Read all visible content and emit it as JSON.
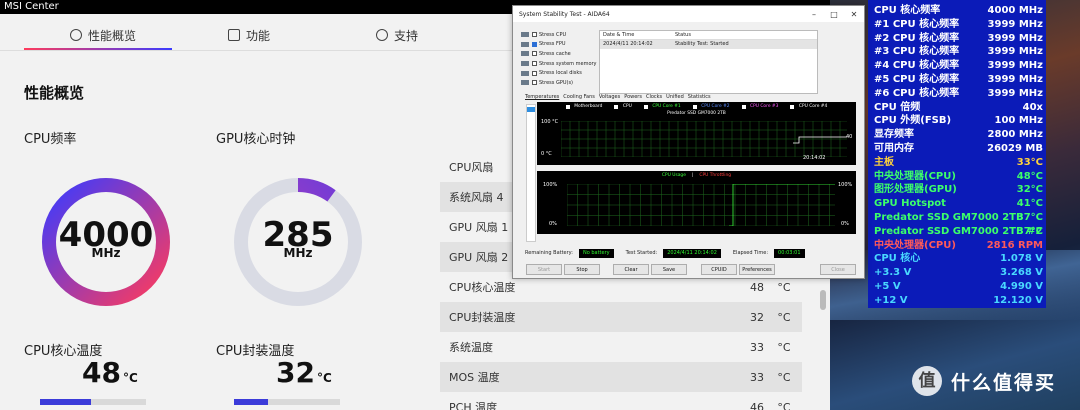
{
  "msi": {
    "title": "MSI Center",
    "tabs": [
      {
        "label": "性能概览",
        "icon": "speedometer-icon",
        "active": true
      },
      {
        "label": "功能",
        "icon": "function-icon",
        "active": false
      },
      {
        "label": "支持",
        "icon": "help-icon",
        "active": false
      }
    ],
    "section_title": "性能概览",
    "cpu_freq": {
      "label": "CPU频率",
      "value": "4000",
      "unit": "MHz",
      "fraction": 1.0
    },
    "gpu_clock": {
      "label": "GPU核心时钟",
      "value": "285",
      "unit": "MHz",
      "fraction": 0.1
    },
    "cpu_core_temp": {
      "label": "CPU核心温度",
      "value": "48",
      "unit": "°C",
      "fraction": 0.48
    },
    "cpu_pkg_temp": {
      "label": "CPU封装温度",
      "value": "32",
      "unit": "°C",
      "fraction": 0.32
    },
    "fans": [
      {
        "name": "CPU风扇",
        "value": "",
        "unit": ""
      },
      {
        "name": "系统风扇 4",
        "value": "",
        "unit": ""
      },
      {
        "name": "GPU 风扇 1",
        "value": "",
        "unit": ""
      },
      {
        "name": "GPU 风扇 2",
        "value": "",
        "unit": ""
      },
      {
        "name": "CPU核心温度",
        "value": "48",
        "unit": "°C"
      },
      {
        "name": "CPU封装温度",
        "value": "32",
        "unit": "°C"
      },
      {
        "name": "系统温度",
        "value": "33",
        "unit": "°C"
      },
      {
        "name": "MOS 温度",
        "value": "33",
        "unit": "°C"
      },
      {
        "name": "PCH 温度",
        "value": "46",
        "unit": "°C"
      }
    ],
    "accent_gradient": [
      "#ff3b5c",
      "#3b3bff"
    ]
  },
  "osd": {
    "rows": [
      {
        "key": "CPU 核心频率",
        "value": "4000 MHz",
        "color": "#ffffff"
      },
      {
        "key": "#1 CPU 核心频率",
        "value": "3999 MHz",
        "color": "#ffffff"
      },
      {
        "key": "#2 CPU 核心频率",
        "value": "3999 MHz",
        "color": "#ffffff"
      },
      {
        "key": "#3 CPU 核心频率",
        "value": "3999 MHz",
        "color": "#ffffff"
      },
      {
        "key": "#4 CPU 核心频率",
        "value": "3999 MHz",
        "color": "#ffffff"
      },
      {
        "key": "#5 CPU 核心频率",
        "value": "3999 MHz",
        "color": "#ffffff"
      },
      {
        "key": "#6 CPU 核心频率",
        "value": "3999 MHz",
        "color": "#ffffff"
      },
      {
        "key": "CPU 倍频",
        "value": "40x",
        "color": "#ffffff"
      },
      {
        "key": "CPU 外频(FSB)",
        "value": "100 MHz",
        "color": "#ffffff"
      },
      {
        "key": "显存频率",
        "value": "2800 MHz",
        "color": "#ffffff"
      },
      {
        "key": "可用内存",
        "value": "26029 MB",
        "color": "#ffffff"
      },
      {
        "key": "主板",
        "value": "33°C",
        "color": "#ffd23c"
      },
      {
        "key": "中央处理器(CPU)",
        "value": "48°C",
        "color": "#3cff6a"
      },
      {
        "key": "图形处理器(GPU)",
        "value": "32°C",
        "color": "#3cff6a"
      },
      {
        "key": "GPU Hotspot",
        "value": "41°C",
        "color": "#3cff6a"
      },
      {
        "key": "Predator SSD GM7000 2TB",
        "value": "37°C",
        "color": "#3cff6a"
      },
      {
        "key": "Predator SSD GM7000 2TB #2",
        "value": "37°C",
        "color": "#3cff6a"
      },
      {
        "key": "中央处理器(CPU)",
        "value": "2816 RPM",
        "color": "#ff5a5a"
      },
      {
        "key": "CPU 核心",
        "value": "1.078 V",
        "color": "#49d8ff"
      },
      {
        "key": "+3.3 V",
        "value": "3.268 V",
        "color": "#49d8ff"
      },
      {
        "key": "+5 V",
        "value": "4.990 V",
        "color": "#49d8ff"
      },
      {
        "key": "+12 V",
        "value": "12.120 V",
        "color": "#49d8ff"
      }
    ]
  },
  "aida": {
    "title": "System Stability Test - AIDA64",
    "stress_items": [
      {
        "label": "Stress CPU",
        "checked": false
      },
      {
        "label": "Stress FPU",
        "checked": true
      },
      {
        "label": "Stress cache",
        "checked": false
      },
      {
        "label": "Stress system memory",
        "checked": false
      },
      {
        "label": "Stress local disks",
        "checked": false
      },
      {
        "label": "Stress GPU(s)",
        "checked": false
      }
    ],
    "log_headers": [
      "Date & Time",
      "Status"
    ],
    "log_rows": [
      {
        "time": "2024/4/11 20:14:02",
        "status": "Stability Test: Started"
      }
    ],
    "tabs": [
      "Temperatures",
      "Cooling Fans",
      "Voltages",
      "Powers",
      "Clocks",
      "Unified",
      "Statistics"
    ],
    "temp_graph": {
      "legend": [
        "Motherboard",
        "CPU",
        "CPU Core #1",
        "CPU Core #2",
        "CPU Core #3",
        "CPU Core #4"
      ],
      "legend_colors": [
        "#ffffff",
        "#ffffff",
        "#3cff3c",
        "#5a8cff",
        "#ff5aff",
        "#ffffff"
      ],
      "legend2": "Predator SSD GM7000 2TB",
      "y_max": "100 °C",
      "y_min": "0 °C",
      "time_label": "20:14:02",
      "end_value": "40"
    },
    "usage_graph": {
      "legend_a": "CPU Usage",
      "legend_sep": "|",
      "legend_b": "CPU Throttling",
      "y_top_left": "100%",
      "y_bottom_left": "0%",
      "y_top_right": "100%",
      "y_bottom_right": "0%"
    },
    "status": {
      "battery_label": "Remaining Battery:",
      "battery_value": "No battery",
      "started_label": "Test Started:",
      "started_value": "2024/4/11 20:14:02",
      "elapsed_label": "Elapsed Time:",
      "elapsed_value": "00:03:01"
    },
    "buttons": [
      {
        "label": "Start",
        "enabled": false
      },
      {
        "label": "Stop",
        "enabled": true
      },
      {
        "label": "Clear",
        "enabled": true
      },
      {
        "label": "Save",
        "enabled": true
      },
      {
        "label": "CPUID",
        "enabled": true
      },
      {
        "label": "Preferences",
        "enabled": true
      },
      {
        "label": "Close",
        "enabled": false
      }
    ]
  },
  "watermark": {
    "logo": "值",
    "text": "什么值得买"
  }
}
